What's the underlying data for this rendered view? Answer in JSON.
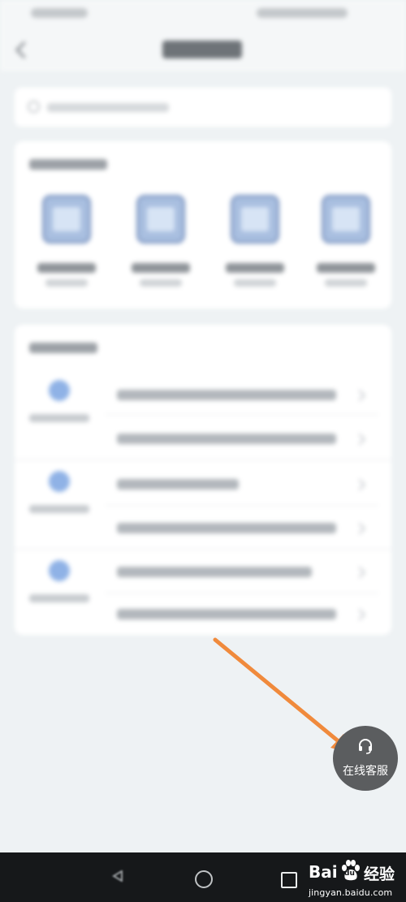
{
  "customer_service": {
    "label": "在线客服",
    "icon": "headset-icon",
    "background": "#5b5d5f"
  },
  "annotation": {
    "arrow_color": "#f08a3c"
  },
  "watermark": {
    "brand_bai": "Bai",
    "brand_du": "du",
    "brand_suffix": "经验",
    "url": "jingyan.baidu.com"
  },
  "nav": {
    "buttons": [
      "back-icon",
      "home-icon",
      "recent-apps-icon"
    ]
  },
  "theme": {
    "page_bg": "#eef2f4",
    "card_bg": "#ffffff",
    "tool_icon_color": "#a9bfe0",
    "nav_bg": "#16181a"
  }
}
